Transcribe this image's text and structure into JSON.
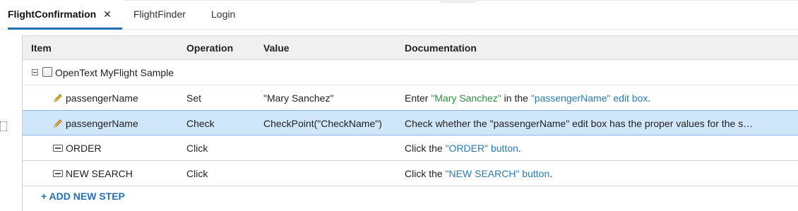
{
  "tabs": [
    {
      "label": "FlightConfirmation",
      "active": true,
      "close_glyph": "✕"
    },
    {
      "label": "FlightFinder",
      "active": false
    },
    {
      "label": "Login",
      "active": false
    }
  ],
  "grid": {
    "columns": {
      "item": "Item",
      "operation": "Operation",
      "value": "Value",
      "documentation": "Documentation"
    },
    "group": {
      "label": "OpenText MyFlight Sample",
      "expanded": true
    },
    "steps": [
      {
        "icon": "pencil-icon",
        "item": "passengerName",
        "operation": "Set",
        "value": "\"Mary Sanchez\"",
        "doc": {
          "prefix": "Enter ",
          "quoted_value": "\"Mary Sanchez\"",
          "middle": " in the ",
          "target": "\"passengerName\" edit box",
          "suffix": "."
        }
      },
      {
        "icon": "pencil-icon",
        "item": "passengerName",
        "operation": "Check",
        "value": "CheckPoint(\"CheckName\")",
        "doc_text": "Check whether the \"passengerName\" edit box has the proper values for the s…",
        "selected": true
      },
      {
        "icon": "button-icon",
        "item": "ORDER",
        "operation": "Click",
        "value": "",
        "doc": {
          "prefix": "Click the ",
          "target": "\"ORDER\" button",
          "suffix": "."
        }
      },
      {
        "icon": "button-icon",
        "item": "NEW SEARCH",
        "operation": "Click",
        "value": "",
        "doc": {
          "prefix": "Click the ",
          "target": "\"NEW SEARCH\" button",
          "suffix": "."
        }
      }
    ],
    "add_step_label": "+ ADD NEW STEP"
  },
  "colors": {
    "accent": "#2470b8",
    "selected_row": "#cfe6fb",
    "doc_value_green": "#2e8b3d",
    "doc_target_blue": "#2c7bb0"
  }
}
